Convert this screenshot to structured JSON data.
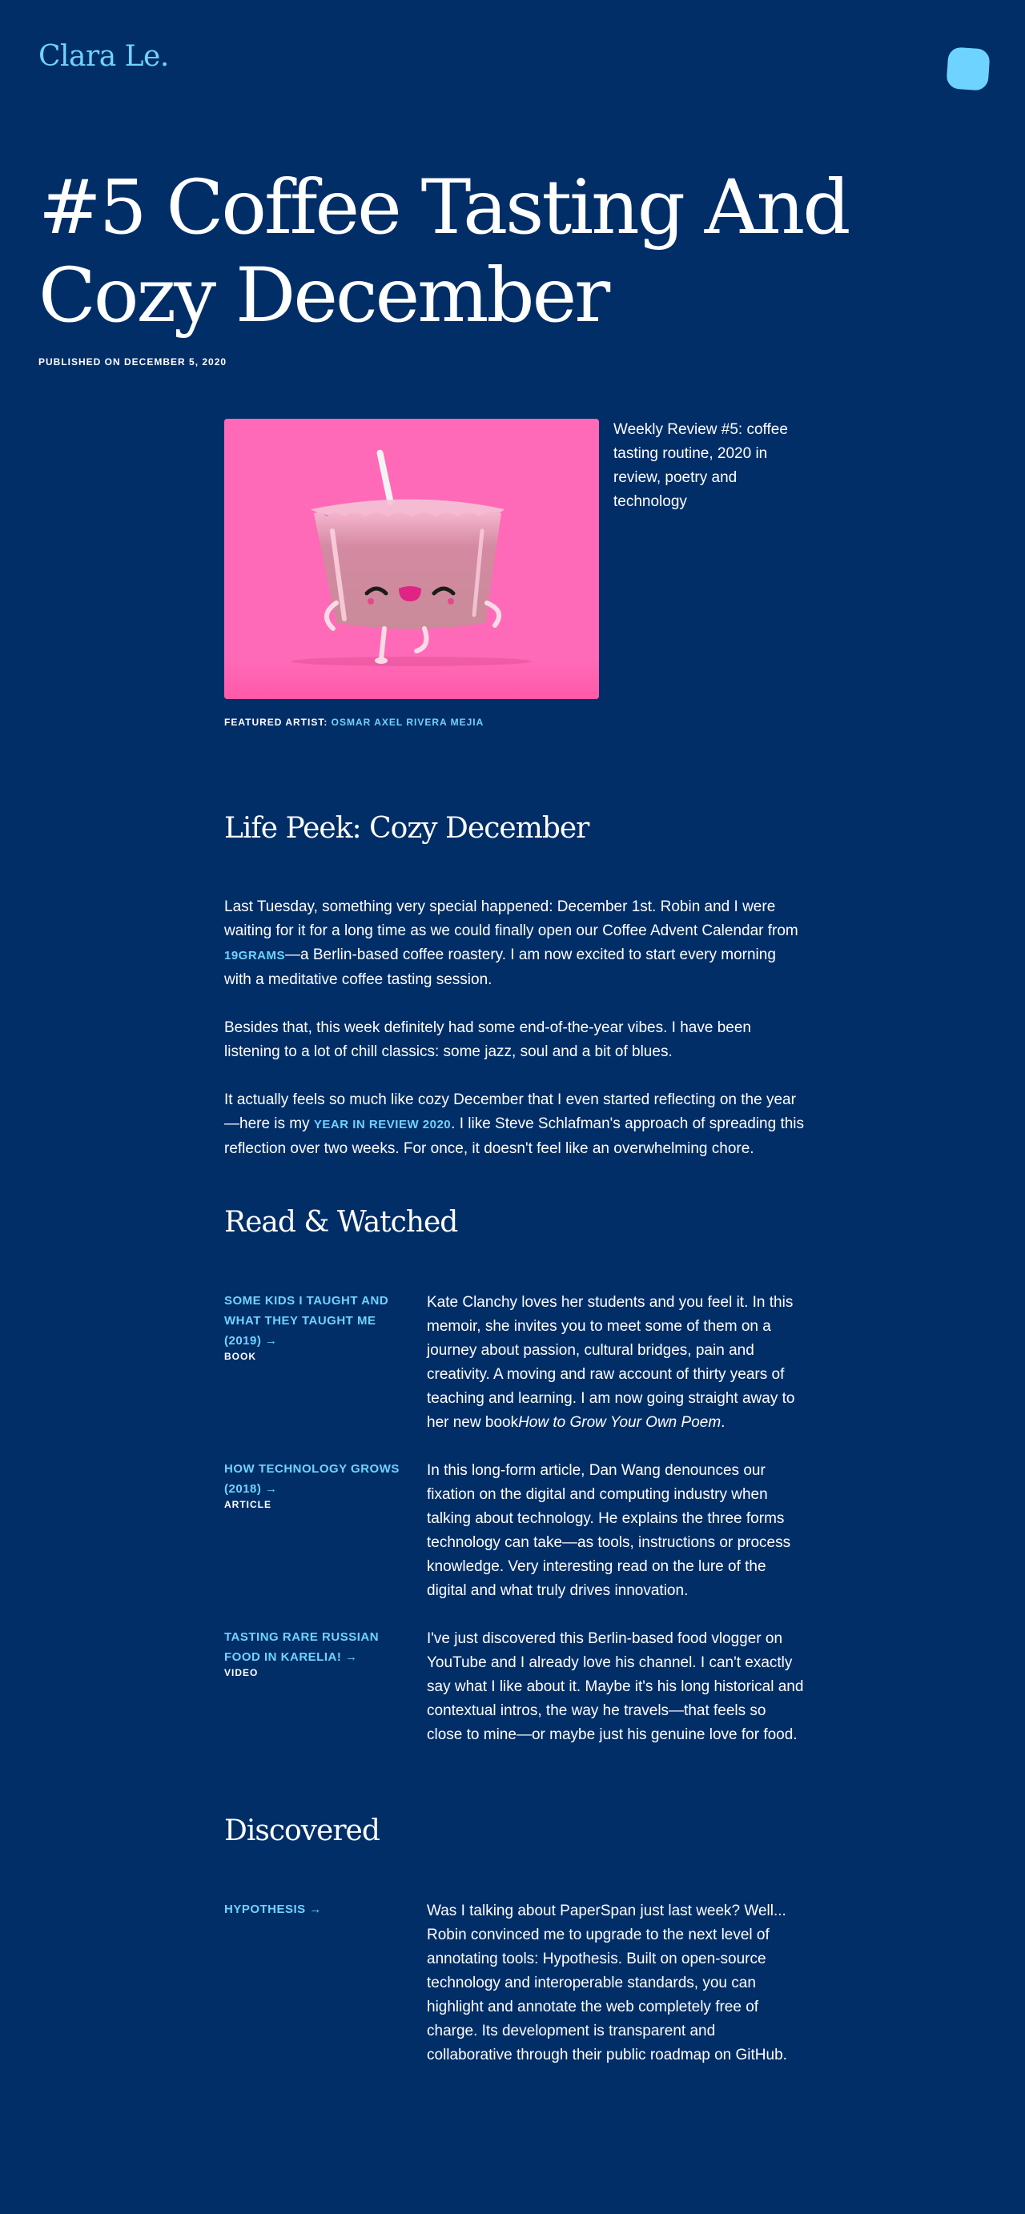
{
  "header": {
    "logo": "Clara Le.",
    "menu_icon": "blob-menu-icon"
  },
  "post": {
    "title": "#5 Coffee Tasting And Cozy December",
    "published": "PUBLISHED ON DECEMBER 5, 2020"
  },
  "hero": {
    "image_icon": "cup-character-illustration",
    "caption": "Weekly Review #5: coffee tasting routine, 2020 in review, poetry and technology",
    "featured_label": "FEATURED ARTIST: ",
    "featured_link": "OSMAR AXEL RIVERA MEJIA"
  },
  "life_peek": {
    "title": "Life Peek: Cozy December",
    "p1_a": "Last Tuesday, something very special happened: December 1st. Robin and I were waiting for it for a long time as we could finally open our Coffee Advent Calendar from ",
    "p1_link": "19GRAMS",
    "p1_b": "—a Berlin-based coffee roastery. I am now excited to start every morning with a meditative coffee tasting session.",
    "p2": "Besides that, this week definitely had some end-of-the-year vibes. I have been listening to a lot of chill classics: some jazz, soul and a bit of blues.",
    "p3_a": "It actually feels so much like cozy December that I even started reflecting on the year—here is my ",
    "p3_link": "YEAR IN REVIEW 2020",
    "p3_b": ". I like Steve Schlafman's approach of spreading this reflection over two weeks. For once, it doesn't feel like an overwhelming chore."
  },
  "read_watched": {
    "title": "Read & Watched",
    "items": [
      {
        "link": "SOME KIDS I TAUGHT AND WHAT THEY TAUGHT ME (2019)",
        "type": "BOOK",
        "text_a": "Kate Clanchy loves her students and you feel it. In this memoir, she invites you to meet some of them on a journey about passion, cultural bridges, pain and creativity. A moving and raw account of thirty years of teaching and learning. I am now going straight away to her new book",
        "text_em": "How to Grow Your Own Poem",
        "text_b": "."
      },
      {
        "link": "HOW TECHNOLOGY GROWS (2018)",
        "type": "ARTICLE",
        "text": "In this long-form article, Dan Wang denounces our fixation on the digital and computing industry when talking about technology. He explains the three forms technology can take—as tools, instructions or process knowledge. Very interesting read on the lure of the digital and what truly drives innovation."
      },
      {
        "link": "TASTING RARE RUSSIAN FOOD IN KARELIA!",
        "type": "VIDEO",
        "text": "I've just discovered this Berlin-based food vlogger on YouTube and I already love his channel. I can't exactly say what I like about it. Maybe it's his long historical and contextual intros, the way he travels—that feels so close to mine—or maybe just his genuine love for food."
      }
    ]
  },
  "discovered": {
    "title": "Discovered",
    "items": [
      {
        "link": "HYPOTHESIS",
        "text": "Was I talking about PaperSpan just last week? Well... Robin convinced me to upgrade to the next level of annotating tools: Hypothesis. Built on open-source technology and interoperable standards, you can highlight and annotate the web completely free of charge. Its development is transparent and collaborative through their public roadmap on GitHub."
      }
    ]
  },
  "icons": {
    "arrow": "→"
  },
  "colors": {
    "background": "#022e68",
    "accent": "#6fd3ff",
    "hero_background": "#ff6ab8",
    "text": "#ffffff"
  }
}
